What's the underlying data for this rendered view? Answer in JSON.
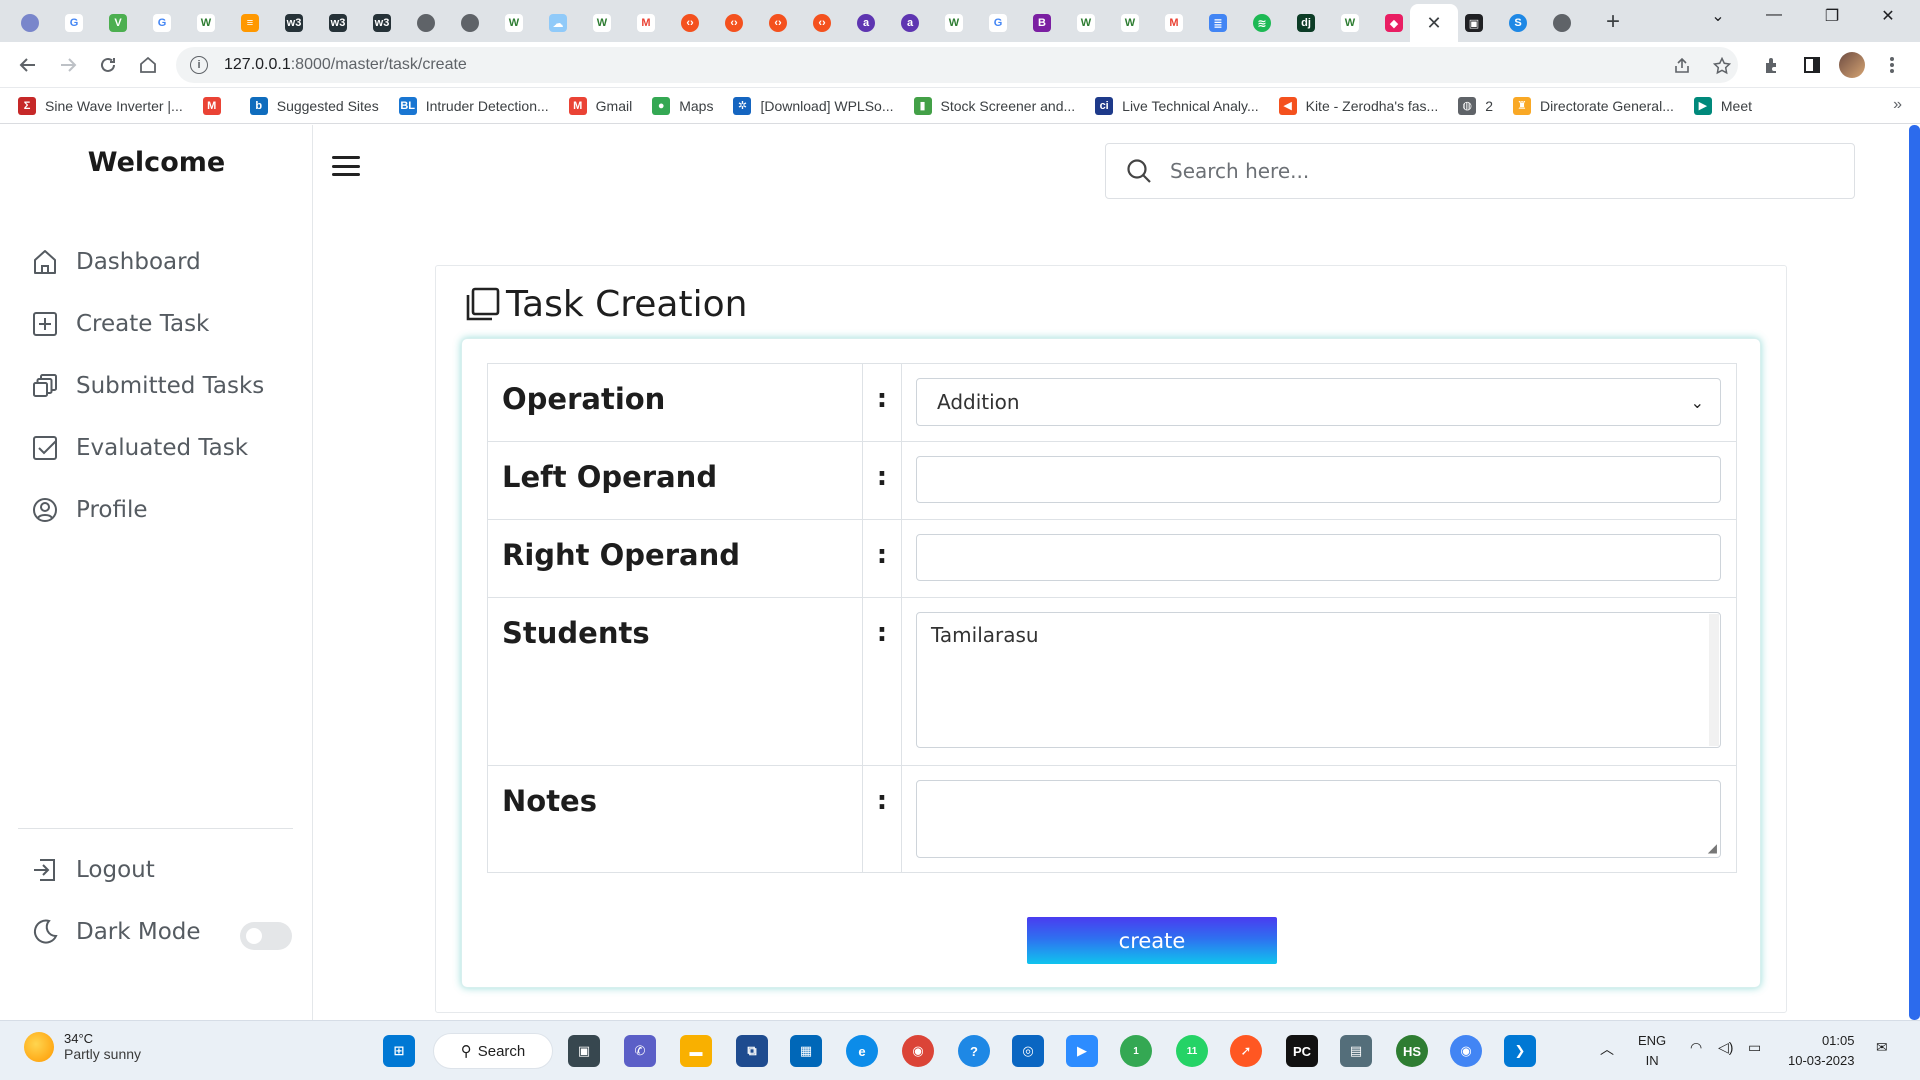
{
  "browser": {
    "url_host": "127.0.0.1",
    "url_path": ":8000/master/task/create",
    "tab_close_glyph": "✕",
    "new_tab_glyph": "+",
    "bookmarks": [
      {
        "label": "Sine Wave Inverter |...",
        "icon": "sigma-icon",
        "color": "#c62828",
        "glyph": "Σ"
      },
      {
        "label": "",
        "icon": "gmail-icon",
        "color": "#ea4335",
        "glyph": "M"
      },
      {
        "label": "Suggested Sites",
        "icon": "bing-icon",
        "color": "#0f6cbd",
        "glyph": "b"
      },
      {
        "label": "Intruder Detection...",
        "icon": "bl-icon",
        "color": "#1976d2",
        "glyph": "BL"
      },
      {
        "label": "Gmail",
        "icon": "gmail-icon",
        "color": "#ea4335",
        "glyph": "M"
      },
      {
        "label": "Maps",
        "icon": "maps-pin-icon",
        "color": "#34a853",
        "glyph": "●"
      },
      {
        "label": "[Download] WPLSo...",
        "icon": "gear-icon",
        "color": "#1565c0",
        "glyph": "✲"
      },
      {
        "label": "Stock Screener and...",
        "icon": "bar-chart-icon",
        "color": "#43a047",
        "glyph": "▮"
      },
      {
        "label": "Live Technical Analy...",
        "icon": "ci-icon",
        "color": "#1e3a8a",
        "glyph": "ci"
      },
      {
        "label": "Kite - Zerodha's fas...",
        "icon": "kite-icon",
        "color": "#f4511e",
        "glyph": "◀"
      },
      {
        "label": "2",
        "icon": "globe-icon",
        "color": "#5f6368",
        "glyph": "◍"
      },
      {
        "label": "Directorate General...",
        "icon": "emblem-icon",
        "color": "#f9a825",
        "glyph": "♜"
      },
      {
        "label": "Meet",
        "icon": "meet-icon",
        "color": "#00897b",
        "glyph": "▶"
      }
    ],
    "more_glyph": "»"
  },
  "sidebar": {
    "brand": "Welcome",
    "items": [
      {
        "label": "Dashboard",
        "icon": "home-icon"
      },
      {
        "label": "Create Task",
        "icon": "plus-square-icon"
      },
      {
        "label": "Submitted Tasks",
        "icon": "copy-stack-icon"
      },
      {
        "label": "Evaluated Task",
        "icon": "check-square-icon"
      },
      {
        "label": "Profile",
        "icon": "user-circle-icon"
      }
    ],
    "logout": "Logout",
    "dark_mode": "Dark Mode",
    "dark_mode_on": false
  },
  "search": {
    "placeholder": "Search here..."
  },
  "form": {
    "title": "Task Creation",
    "colon": ":",
    "fields": {
      "operation": {
        "label": "Operation",
        "value": "Addition"
      },
      "left": {
        "label": "Left Operand",
        "value": ""
      },
      "right": {
        "label": "Right Operand",
        "value": ""
      },
      "students": {
        "label": "Students",
        "options": [
          "Tamilarasu"
        ]
      },
      "notes": {
        "label": "Notes",
        "value": ""
      }
    },
    "submit_label": "create"
  },
  "taskbar": {
    "temperature": "34°C",
    "weather": "Partly sunny",
    "search_label": "Search",
    "lang_1": "ENG",
    "lang_2": "IN",
    "time": "01:05",
    "date": "10-03-2023",
    "whatsapp_badge": "11",
    "chrome_badge": "1",
    "tray_up_glyph": "︿"
  },
  "colors": {
    "accent": "#2c6bed",
    "button_gradient_top": "#4a3cf0",
    "button_gradient_bottom": "#10c4ee",
    "card_glow": "#20b2aa"
  }
}
